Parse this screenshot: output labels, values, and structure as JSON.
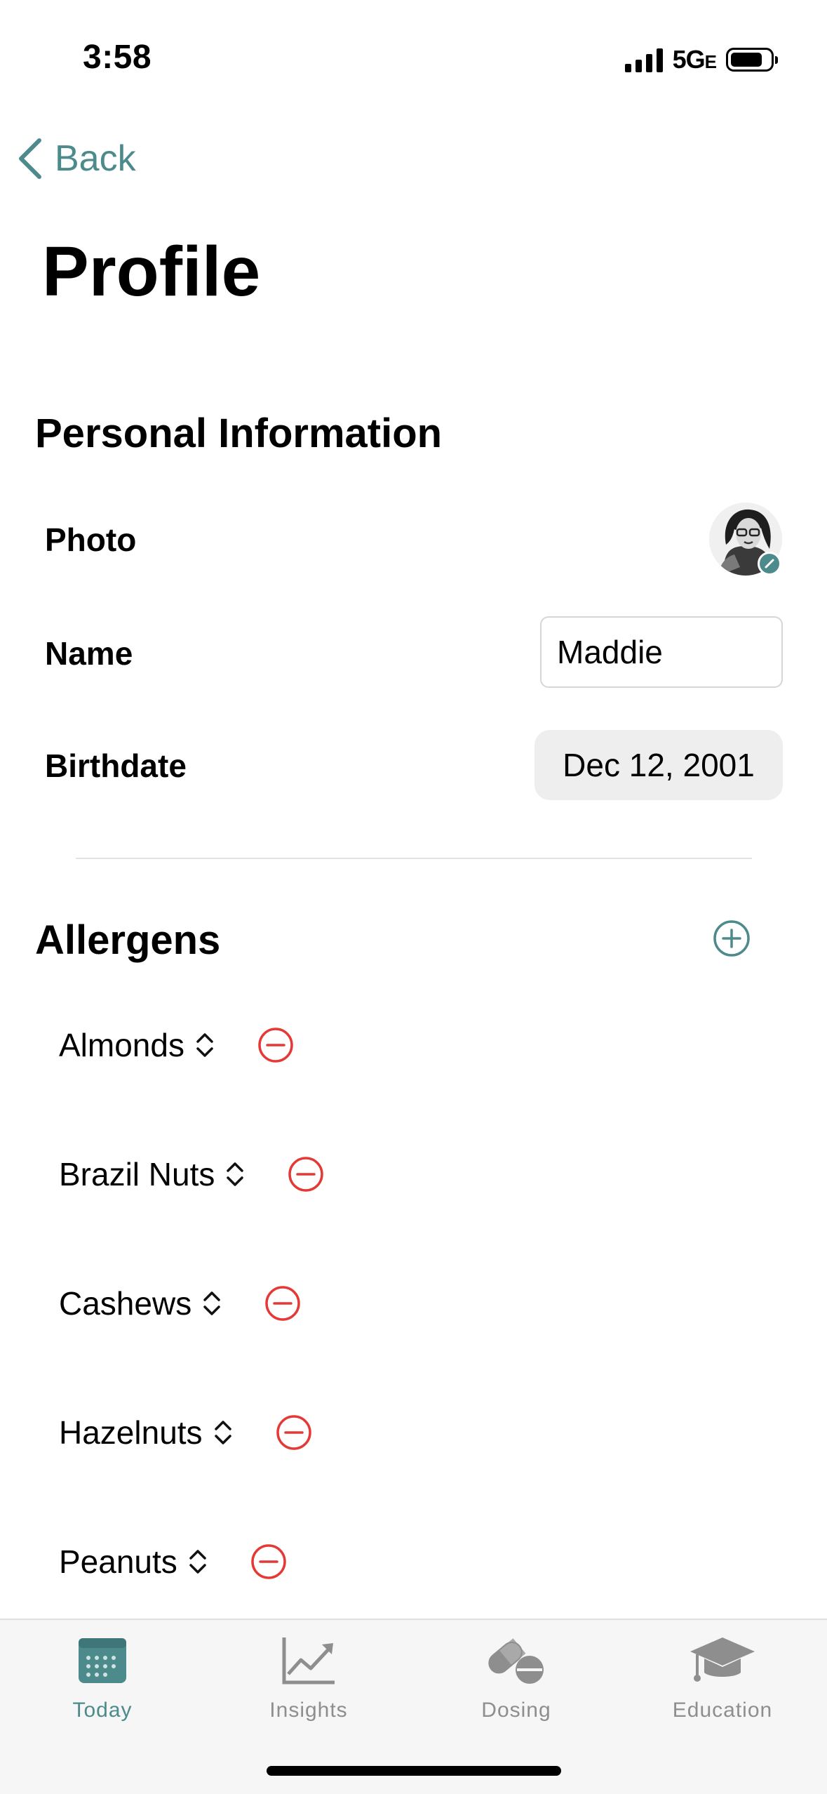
{
  "status_bar": {
    "time": "3:58",
    "network": "5G",
    "network_suffix": "E"
  },
  "nav": {
    "back_label": "Back"
  },
  "page": {
    "title": "Profile"
  },
  "personal_info": {
    "title": "Personal Information",
    "photo_label": "Photo",
    "name_label": "Name",
    "name_value": "Maddie",
    "birthdate_label": "Birthdate",
    "birthdate_value": "Dec 12, 2001"
  },
  "allergens": {
    "title": "Allergens",
    "items": [
      {
        "label": "Almonds"
      },
      {
        "label": "Brazil Nuts"
      },
      {
        "label": "Cashews"
      },
      {
        "label": "Hazelnuts"
      },
      {
        "label": "Peanuts"
      }
    ]
  },
  "tabbar": {
    "tabs": [
      {
        "label": "Today",
        "icon": "calendar-icon",
        "active": true
      },
      {
        "label": "Insights",
        "icon": "chart-icon",
        "active": false
      },
      {
        "label": "Dosing",
        "icon": "pill-icon",
        "active": false
      },
      {
        "label": "Education",
        "icon": "graduation-cap-icon",
        "active": false
      }
    ]
  },
  "colors": {
    "accent": "#4d8a8b",
    "remove": "#e53935",
    "tab_inactive": "#8e8e8e"
  }
}
